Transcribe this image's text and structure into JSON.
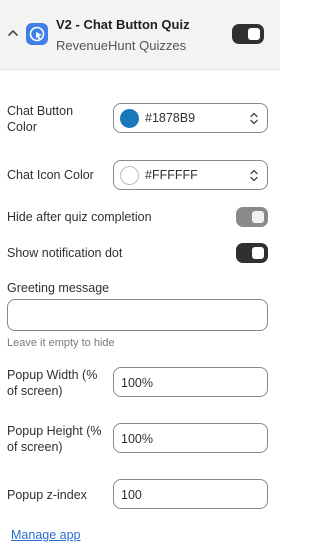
{
  "header": {
    "title": "V2 - Chat Button Quiz",
    "subtitle": "RevenueHunt Quizzes",
    "app_icon": "chat-cursor-icon",
    "accent": "#3f7fe8",
    "enabled": true
  },
  "fields": {
    "chat_button_color": {
      "label": "Chat Button Color",
      "value": "#1878B9",
      "swatch": "#1878B9"
    },
    "chat_icon_color": {
      "label": "Chat Icon Color",
      "value": "#FFFFFF",
      "swatch": "#FFFFFF"
    },
    "hide_after_completion": {
      "label": "Hide after quiz completion",
      "enabled": false
    },
    "show_notification_dot": {
      "label": "Show notification dot",
      "enabled": true
    },
    "greeting_message": {
      "label": "Greeting message",
      "value": "",
      "help": "Leave it empty to hide"
    },
    "popup_width": {
      "label": "Popup Width (% of screen)",
      "value": "100%"
    },
    "popup_height": {
      "label": "Popup Height (% of screen)",
      "value": "100%"
    },
    "popup_z_index": {
      "label": "Popup z-index",
      "value": "100"
    }
  },
  "footer": {
    "manage_link": "Manage app"
  }
}
